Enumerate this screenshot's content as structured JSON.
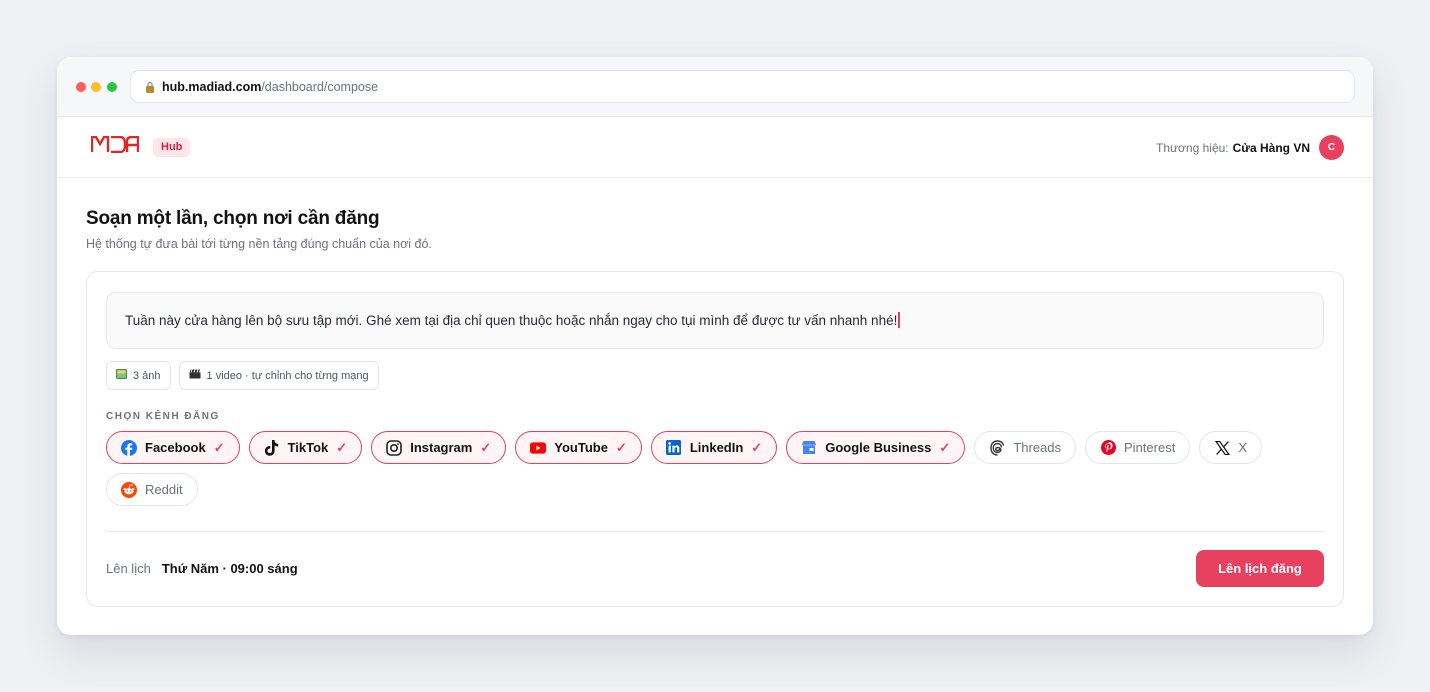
{
  "browser": {
    "url_host": "hub.madiad.com",
    "url_path": "/dashboard/compose"
  },
  "app": {
    "badge": "Hub",
    "brand_label": "Thương hiệu:",
    "brand_name": "Cửa Hàng VN",
    "avatar_initial": "C"
  },
  "page": {
    "title": "Soạn một lần, chọn nơi cần đăng",
    "subtitle": "Hệ thống tự đưa bài tới từng nền tảng đúng chuẩn của nơi đó."
  },
  "composer": {
    "text": "Tuần này cửa hàng lên bộ sưu tập mới. Ghé xem tại địa chỉ quen thuộc hoặc nhắn ngay cho tụi mình để được tư vấn nhanh nhé!",
    "attachments": [
      {
        "icon": "image-icon",
        "label": "3 ảnh"
      },
      {
        "icon": "clapper-icon",
        "label": "1 video · tự chỉnh cho từng mạng"
      }
    ]
  },
  "channels": {
    "label": "CHỌN KÊNH ĐĂNG",
    "items": [
      {
        "name": "Facebook",
        "selected": true,
        "icon": "facebook-icon"
      },
      {
        "name": "TikTok",
        "selected": true,
        "icon": "tiktok-icon"
      },
      {
        "name": "Instagram",
        "selected": true,
        "icon": "instagram-icon"
      },
      {
        "name": "YouTube",
        "selected": true,
        "icon": "youtube-icon"
      },
      {
        "name": "LinkedIn",
        "selected": true,
        "icon": "linkedin-icon"
      },
      {
        "name": "Google Business",
        "selected": true,
        "icon": "google-business-icon"
      },
      {
        "name": "Threads",
        "selected": false,
        "icon": "threads-icon"
      },
      {
        "name": "Pinterest",
        "selected": false,
        "icon": "pinterest-icon"
      },
      {
        "name": "X",
        "selected": false,
        "icon": "x-icon"
      },
      {
        "name": "Reddit",
        "selected": false,
        "icon": "reddit-icon"
      }
    ],
    "check_mark": "✓"
  },
  "schedule": {
    "label": "Lên lịch",
    "value": "Thứ Năm · 09:00 sáng",
    "button": "Lên lịch đăng"
  },
  "colors": {
    "accent": "#e8415f",
    "facebook": "#1877f2",
    "youtube": "#ff0000",
    "linkedin": "#0a66c2",
    "google": "#4285f4",
    "pinterest": "#e60023",
    "reddit": "#ff4500"
  }
}
